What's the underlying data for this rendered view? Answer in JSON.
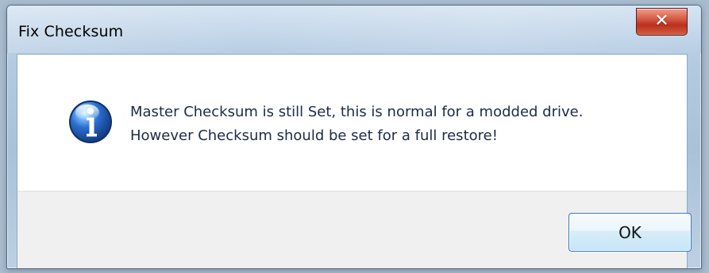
{
  "window": {
    "title": "Fix Checksum"
  },
  "message": {
    "lines": [
      "Master Checksum is still Set, this is normal for a modded drive.",
      "However Checksum should be set for a full restore!"
    ]
  },
  "buttons": {
    "ok": "OK",
    "close": "✕"
  },
  "icons": {
    "close": "close-icon",
    "info": "info-icon"
  },
  "colors": {
    "title_text": "#000000",
    "message_text": "#1c2b46",
    "close_red": "#c43b28",
    "button_border": "#3b7bbf"
  }
}
